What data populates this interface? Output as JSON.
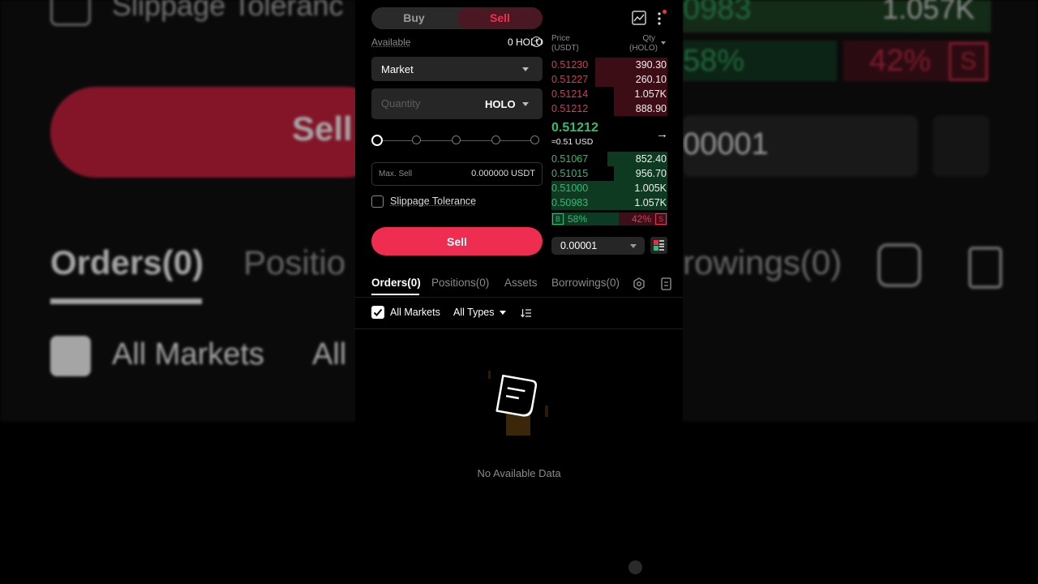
{
  "trade": {
    "side_buy": "Buy",
    "side_sell": "Sell",
    "available_label": "Available",
    "available_value": "0 HOLO",
    "order_type": "Market",
    "quantity_placeholder": "Quantity",
    "quantity_currency": "HOLO",
    "max_sell_label": "Max. Sell",
    "max_sell_value": "0.000000 USDT",
    "slippage_label": "Slippage Tolerance",
    "sell_button": "Sell",
    "slider_percent": 0
  },
  "orderbook": {
    "price_header": "Price",
    "price_unit": "(USDT)",
    "qty_header": "Qty",
    "qty_unit": "(HOLO)",
    "asks": [
      {
        "price": "0.51230",
        "qty": "390.30",
        "depth": 0.62
      },
      {
        "price": "0.51227",
        "qty": "260.10",
        "depth": 0.62
      },
      {
        "price": "0.51214",
        "qty": "1.057K",
        "depth": 0.46
      },
      {
        "price": "0.51212",
        "qty": "888.90",
        "depth": 0.46
      }
    ],
    "last_price": "0.51212",
    "last_price_usd": "≈0.51 USD",
    "bids": [
      {
        "price": "0.51067",
        "qty": "852.40",
        "depth": 0.52
      },
      {
        "price": "0.51015",
        "qty": "956.70",
        "depth": 0.46
      },
      {
        "price": "0.51000",
        "qty": "1.005K",
        "depth": 1.0
      },
      {
        "price": "0.50983",
        "qty": "1.057K",
        "depth": 1.0
      }
    ],
    "buy_badge": "B",
    "sell_badge": "S",
    "buy_ratio": "58%",
    "sell_ratio": "42%",
    "buy_ratio_value": 58,
    "precision": "0.00001"
  },
  "tabs": [
    "Orders(0)",
    "Positions(0)",
    "Assets",
    "Borrowings(0)"
  ],
  "filters": {
    "all_markets": "All Markets",
    "all_types": "All Types"
  },
  "empty_state": "No Available Data",
  "background": {
    "slippage": "Slippage Toleranc",
    "sell": "Sell",
    "orders": "Orders(0)",
    "positions": "Positio",
    "borrowings": "rowings(0)",
    "all_markets": "All Markets",
    "all": "All",
    "num1": "0983",
    "num2": "1.057K",
    "pct_green": "58%",
    "pct_red": "42%",
    "s": "S",
    "precision": "00001"
  },
  "colors": {
    "accent_sell": "#ef2d50",
    "ask_red": "#f0304f",
    "bid_green": "#2fbd73"
  }
}
